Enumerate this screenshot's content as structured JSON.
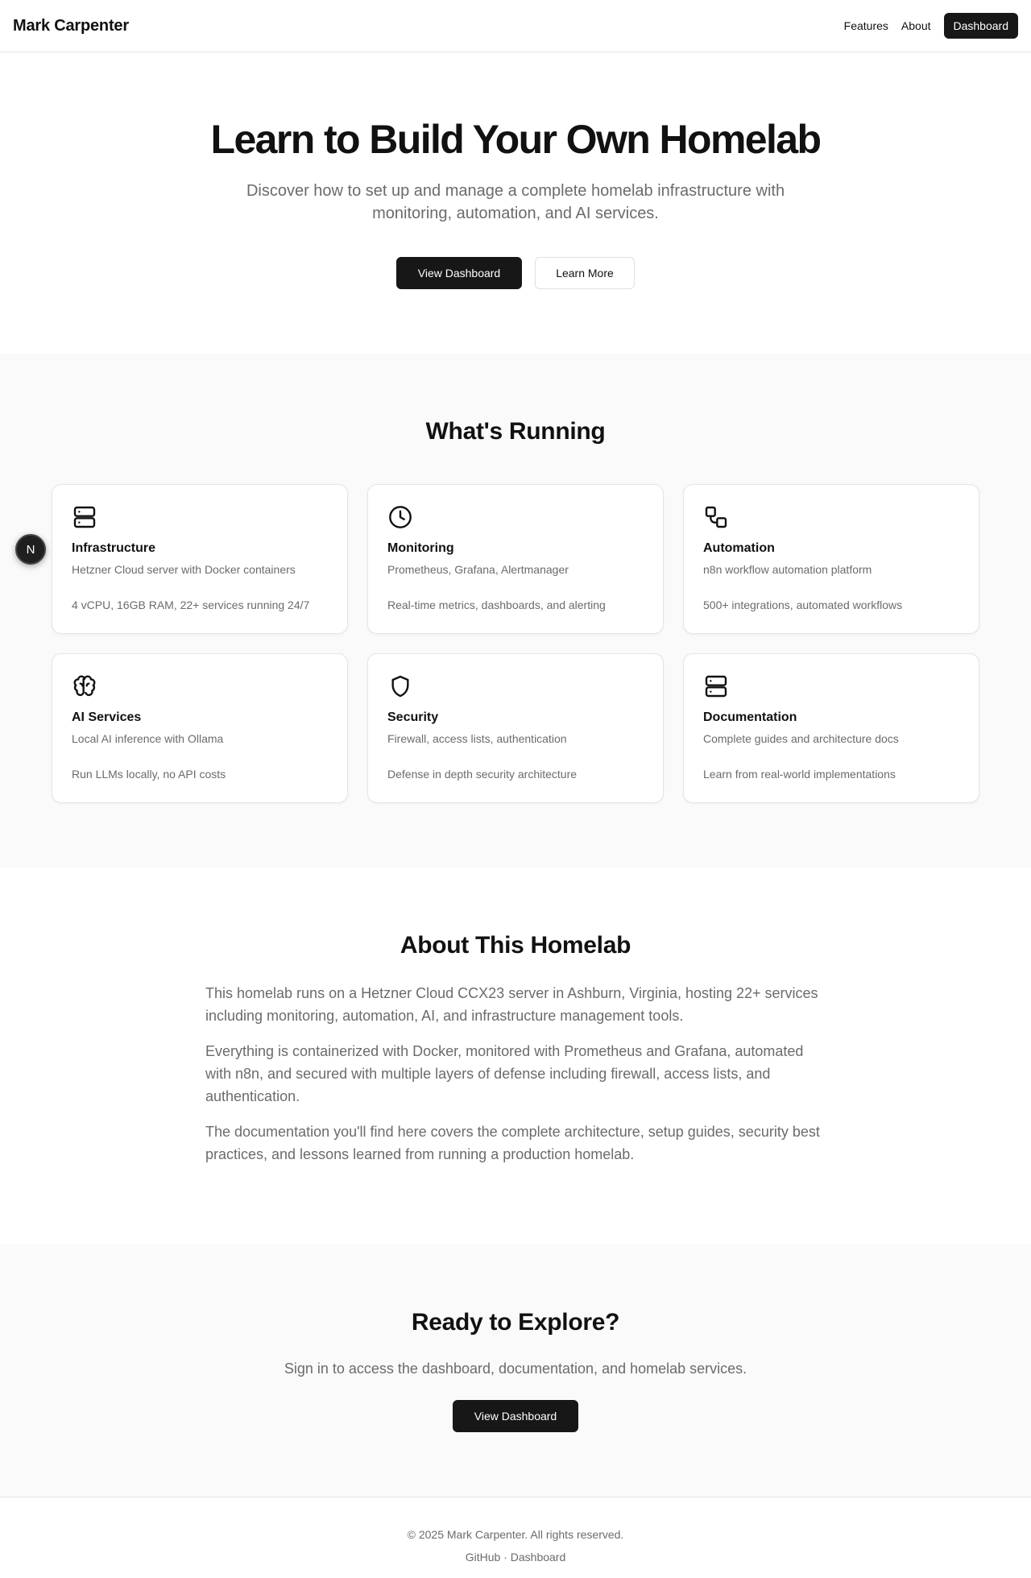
{
  "header": {
    "brand": "Mark Carpenter",
    "nav": {
      "features": "Features",
      "about": "About",
      "dashboard": "Dashboard"
    }
  },
  "hero": {
    "title": "Learn to Build Your Own Homelab",
    "subtitle": "Discover how to set up and manage a complete homelab infrastructure with monitoring, automation, and AI services.",
    "primary": "View Dashboard",
    "secondary": "Learn More"
  },
  "running": {
    "title": "What's Running",
    "cards": [
      {
        "icon": "server-icon",
        "title": "Infrastructure",
        "subtitle": "Hetzner Cloud server with Docker containers",
        "detail": "4 vCPU, 16GB RAM, 22+ services running 24/7"
      },
      {
        "icon": "clock-icon",
        "title": "Monitoring",
        "subtitle": "Prometheus, Grafana, Alertmanager",
        "detail": "Real-time metrics, dashboards, and alerting"
      },
      {
        "icon": "workflow-icon",
        "title": "Automation",
        "subtitle": "n8n workflow automation platform",
        "detail": "500+ integrations, automated workflows"
      },
      {
        "icon": "brain-icon",
        "title": "AI Services",
        "subtitle": "Local AI inference with Ollama",
        "detail": "Run LLMs locally, no API costs"
      },
      {
        "icon": "shield-icon",
        "title": "Security",
        "subtitle": "Firewall, access lists, authentication",
        "detail": "Defense in depth security architecture"
      },
      {
        "icon": "server-icon",
        "title": "Documentation",
        "subtitle": "Complete guides and architecture docs",
        "detail": "Learn from real-world implementations"
      }
    ]
  },
  "about": {
    "title": "About This Homelab",
    "paragraphs": [
      "This homelab runs on a Hetzner Cloud CCX23 server in Ashburn, Virginia, hosting 22+ services including monitoring, automation, AI, and infrastructure management tools.",
      "Everything is containerized with Docker, monitored with Prometheus and Grafana, automated with n8n, and secured with multiple layers of defense including firewall, access lists, and authentication.",
      "The documentation you'll find here covers the complete architecture, setup guides, security best practices, and lessons learned from running a production homelab."
    ]
  },
  "cta": {
    "title": "Ready to Explore?",
    "text": "Sign in to access the dashboard, documentation, and homelab services.",
    "button": "View Dashboard"
  },
  "footer": {
    "copyright": "© 2025 Mark Carpenter. All rights reserved.",
    "github": "GitHub",
    "separator": "·",
    "dashboard": "Dashboard"
  },
  "fab": {
    "label": "N"
  }
}
